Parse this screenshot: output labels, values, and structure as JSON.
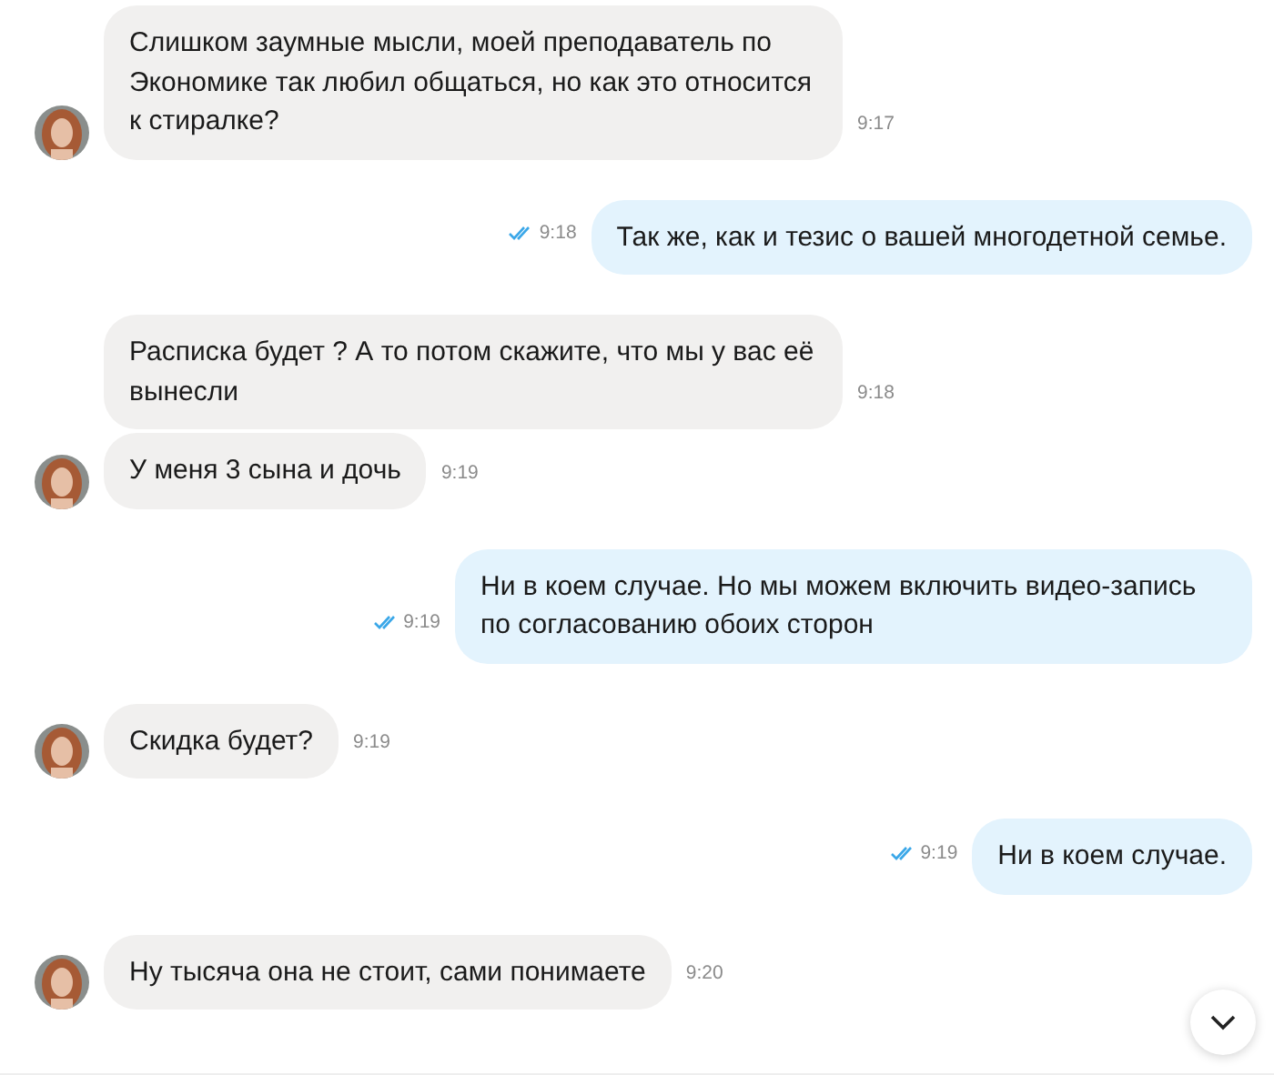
{
  "messages": [
    {
      "kind": "in",
      "text": "Слишком заумные мысли, моей преподаватель по Экономике так любил общаться, но как это относится к стиралке?",
      "time": "9:17",
      "avatar": true
    },
    {
      "kind": "out",
      "text": "Так же, как и тезис о вашей многодетной семье.",
      "time": "9:18",
      "read": true
    },
    {
      "kind": "in",
      "text": "Расписка будет ? А то потом скажите, что мы у вас её вынесли",
      "time": "9:18",
      "avatar": false
    },
    {
      "kind": "in",
      "text": "У меня 3 сына и дочь",
      "time": "9:19",
      "avatar": true
    },
    {
      "kind": "out",
      "text": "Ни в коем случае. Но мы можем включить видео-запись по согласованию обоих сторон",
      "time": "9:19",
      "read": true
    },
    {
      "kind": "in",
      "text": "Скидка будет?",
      "time": "9:19",
      "avatar": true
    },
    {
      "kind": "out",
      "text": "Ни в коем случае.",
      "time": "9:19",
      "read": true
    },
    {
      "kind": "in",
      "text": "Ну тысяча она не стоит, сами понимаете",
      "time": "9:20",
      "avatar": true
    }
  ]
}
